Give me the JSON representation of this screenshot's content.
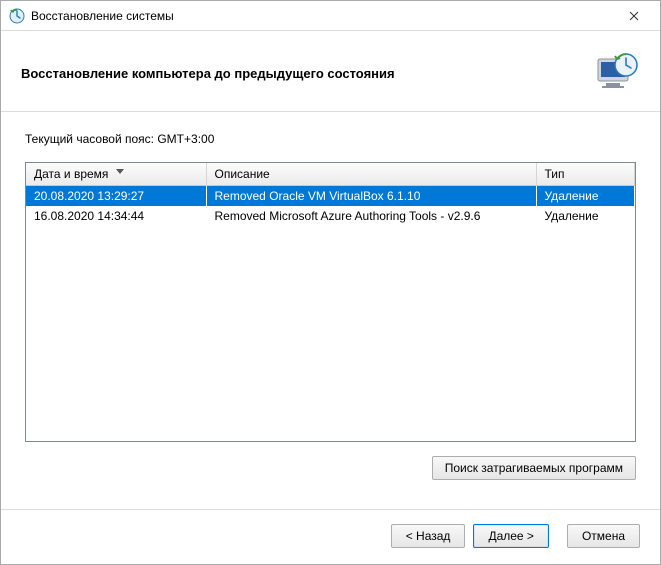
{
  "window": {
    "title": "Восстановление системы"
  },
  "header": {
    "title": "Восстановление компьютера до предыдущего состояния"
  },
  "timezone_label": "Текущий часовой пояс: GMT+3:00",
  "columns": {
    "datetime": "Дата и время",
    "description": "Описание",
    "type": "Тип"
  },
  "rows": [
    {
      "datetime": "20.08.2020 13:29:27",
      "description": "Removed Oracle VM VirtualBox 6.1.10",
      "type": "Удаление",
      "selected": true
    },
    {
      "datetime": "16.08.2020 14:34:44",
      "description": "Removed Microsoft Azure Authoring Tools - v2.9.6",
      "type": "Удаление",
      "selected": false
    }
  ],
  "buttons": {
    "scan": "Поиск затрагиваемых программ",
    "back": "< Назад",
    "next": "Далее >",
    "cancel": "Отмена"
  }
}
